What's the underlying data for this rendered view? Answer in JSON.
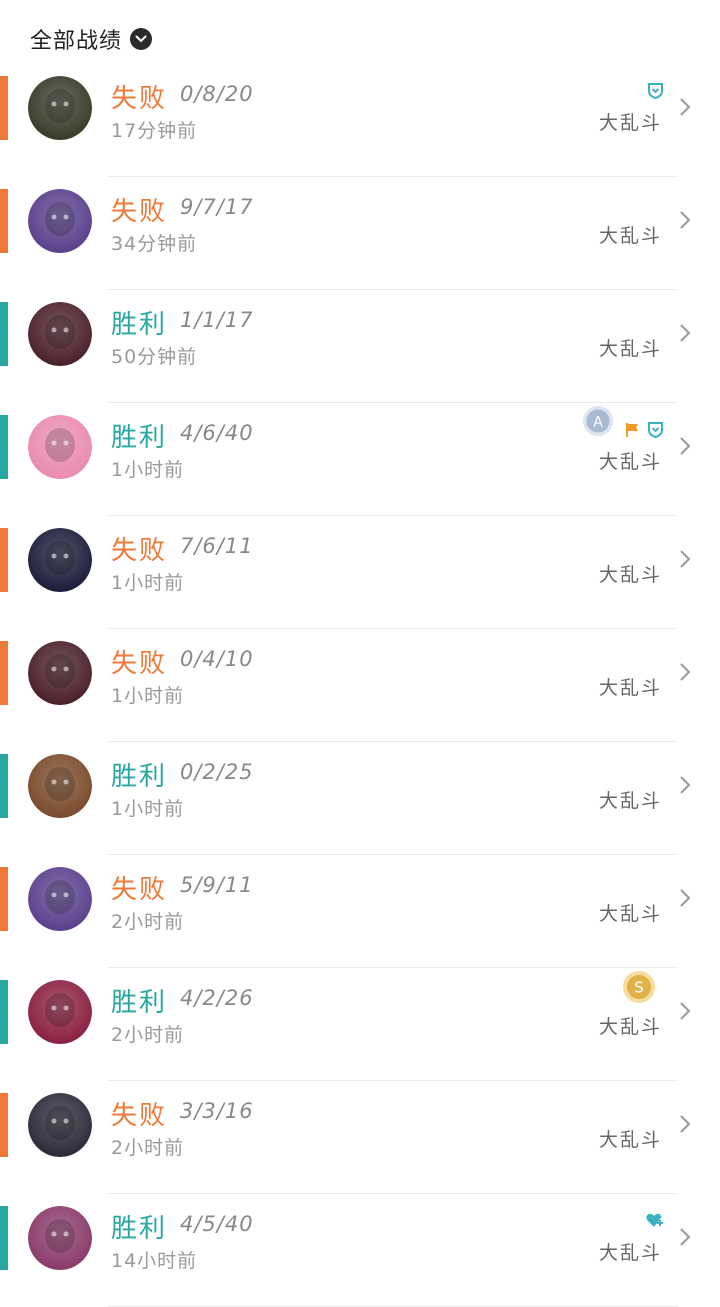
{
  "header": {
    "title": "全部战绩"
  },
  "colors": {
    "loss": "#ee7a3a",
    "win": "#2aa7a0",
    "badge": "#39b3c0"
  },
  "matches": [
    {
      "result": "失败",
      "outcome": "loss",
      "kda": "0/8/20",
      "time": "17分钟前",
      "mode": "大乱斗",
      "badges": [
        "shield-icon"
      ],
      "avatar_color": "#3a3a2a"
    },
    {
      "result": "失败",
      "outcome": "loss",
      "kda": "9/7/17",
      "time": "34分钟前",
      "mode": "大乱斗",
      "badges": [],
      "avatar_color": "#5a3f8c"
    },
    {
      "result": "胜利",
      "outcome": "win",
      "kda": "1/1/17",
      "time": "50分钟前",
      "mode": "大乱斗",
      "badges": [],
      "avatar_color": "#4a1f2a"
    },
    {
      "result": "胜利",
      "outcome": "win",
      "kda": "4/6/40",
      "time": "1小时前",
      "mode": "大乱斗",
      "badges": [
        "flag-icon",
        "shield-icon"
      ],
      "medal": "A",
      "avatar_color": "#e98bb0"
    },
    {
      "result": "失败",
      "outcome": "loss",
      "kda": "7/6/11",
      "time": "1小时前",
      "mode": "大乱斗",
      "badges": [],
      "avatar_color": "#1c1c3a"
    },
    {
      "result": "失败",
      "outcome": "loss",
      "kda": "0/4/10",
      "time": "1小时前",
      "mode": "大乱斗",
      "badges": [],
      "avatar_color": "#4a1f2a"
    },
    {
      "result": "胜利",
      "outcome": "win",
      "kda": "0/2/25",
      "time": "1小时前",
      "mode": "大乱斗",
      "badges": [],
      "avatar_color": "#7a4a2a"
    },
    {
      "result": "失败",
      "outcome": "loss",
      "kda": "5/9/11",
      "time": "2小时前",
      "mode": "大乱斗",
      "badges": [],
      "avatar_color": "#5a3f8c"
    },
    {
      "result": "胜利",
      "outcome": "win",
      "kda": "4/2/26",
      "time": "2小时前",
      "mode": "大乱斗",
      "badges": [],
      "medal": "S",
      "avatar_color": "#8a2040"
    },
    {
      "result": "失败",
      "outcome": "loss",
      "kda": "3/3/16",
      "time": "2小时前",
      "mode": "大乱斗",
      "badges": [],
      "avatar_color": "#2a2a3a"
    },
    {
      "result": "胜利",
      "outcome": "win",
      "kda": "4/5/40",
      "time": "14小时前",
      "mode": "大乱斗",
      "badges": [
        "heart-plus-icon"
      ],
      "avatar_color": "#8a3a6a"
    }
  ]
}
